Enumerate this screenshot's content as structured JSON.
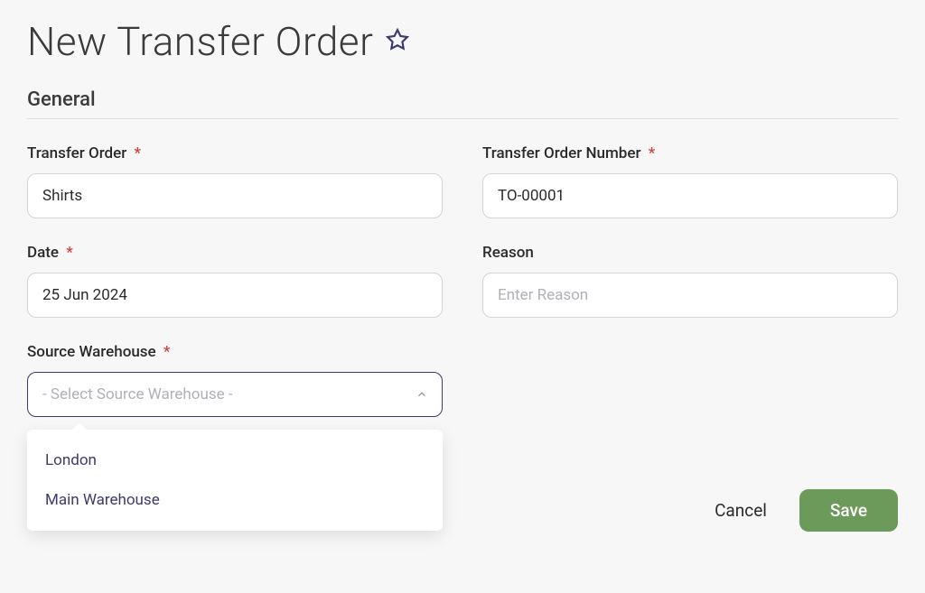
{
  "page": {
    "title": "New Transfer Order"
  },
  "section": {
    "general": "General"
  },
  "fields": {
    "transfer_order": {
      "label": "Transfer Order",
      "value": "Shirts"
    },
    "transfer_order_number": {
      "label": "Transfer Order Number",
      "value": "TO-00001"
    },
    "date": {
      "label": "Date",
      "value": "25 Jun 2024"
    },
    "reason": {
      "label": "Reason",
      "value": "",
      "placeholder": "Enter Reason"
    },
    "source_warehouse": {
      "label": "Source Warehouse",
      "placeholder": "- Select Source Warehouse -",
      "options": [
        "London",
        "Main Warehouse"
      ]
    }
  },
  "actions": {
    "cancel": "Cancel",
    "save": "Save"
  },
  "required_marker": "*",
  "colors": {
    "accent_dark": "#3e3a6e",
    "save_green": "#6c9a5b",
    "required_red": "#d43f3a"
  }
}
